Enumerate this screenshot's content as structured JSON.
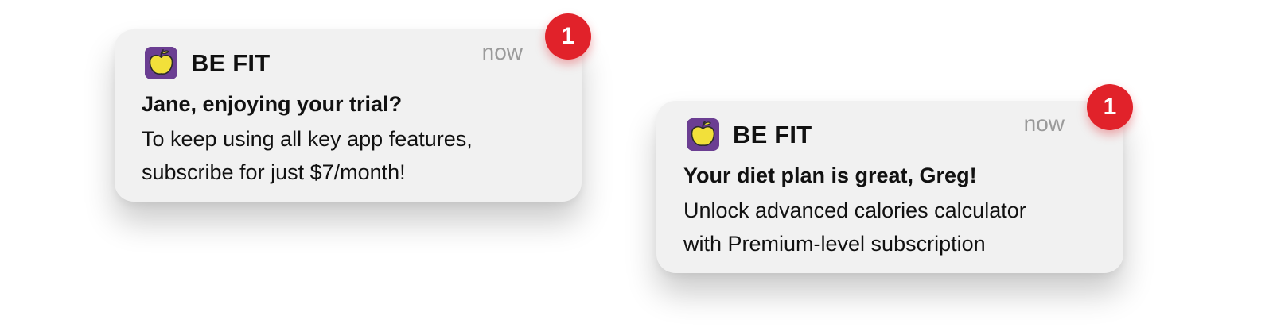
{
  "notifications": [
    {
      "app_name": "BE FIT",
      "time": "now",
      "title": "Jane, enjoying your trial?",
      "body_lines": [
        "To keep using all key app features,",
        "subscribe for just $7/month!"
      ],
      "badge": "1"
    },
    {
      "app_name": "BE FIT",
      "time": "now",
      "title": "Your diet plan is great, Greg!",
      "body_lines": [
        "Unlock advanced calories calculator",
        "with Premium-level subscription"
      ],
      "badge": "1"
    }
  ],
  "colors": {
    "card_background": "#f1f1f1",
    "icon_background": "#6b3e92",
    "apple": "#f2e03a",
    "badge": "#e1222a",
    "time_text": "#9a9a9a"
  },
  "icons": {
    "app_icon": "apple-icon"
  }
}
